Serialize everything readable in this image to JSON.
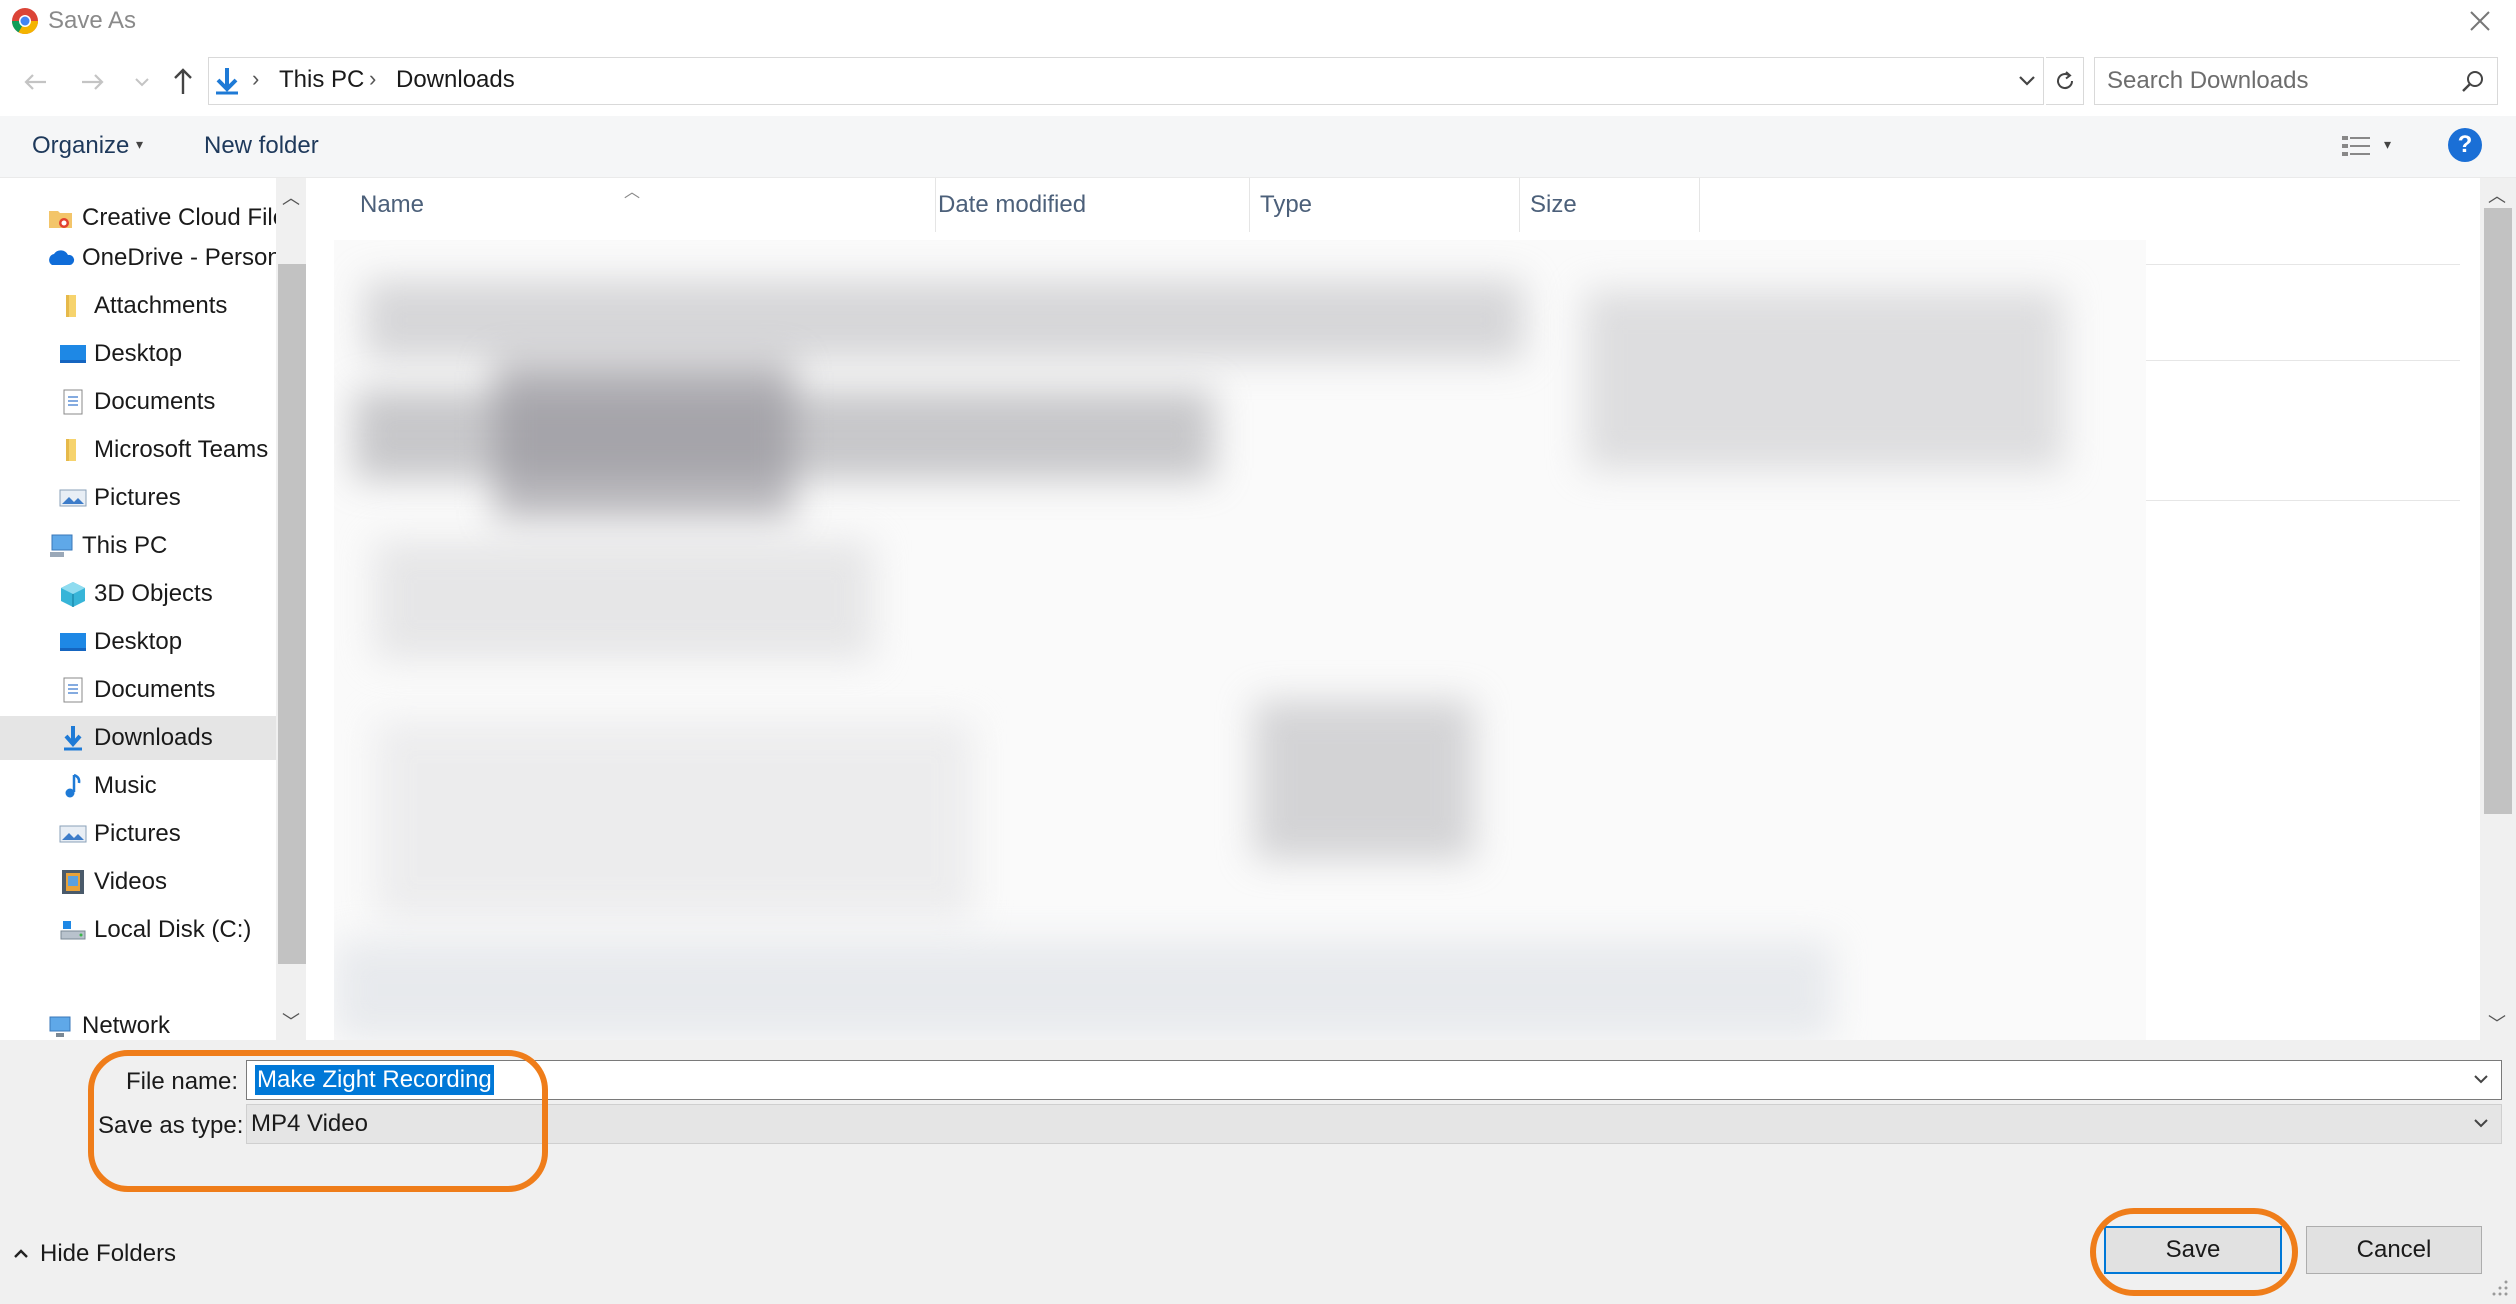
{
  "window": {
    "title": "Save As"
  },
  "address": {
    "breadcrumb": [
      "This PC",
      "Downloads"
    ],
    "search_placeholder": "Search Downloads"
  },
  "toolbar": {
    "organize_label": "Organize",
    "new_folder_label": "New folder",
    "help_label": "?"
  },
  "nav": {
    "items": [
      {
        "label": "Creative Cloud Files",
        "icon": "creative-cloud-folder-icon"
      },
      {
        "label": "OneDrive - Personal",
        "icon": "onedrive-cloud-icon"
      },
      {
        "label": "Attachments",
        "icon": "folder-icon"
      },
      {
        "label": "Desktop",
        "icon": "desktop-icon"
      },
      {
        "label": "Documents",
        "icon": "documents-icon"
      },
      {
        "label": "Microsoft Teams",
        "icon": "folder-icon"
      },
      {
        "label": "Pictures",
        "icon": "pictures-icon"
      },
      {
        "label": "This PC",
        "icon": "this-pc-icon"
      },
      {
        "label": "3D Objects",
        "icon": "3d-objects-icon"
      },
      {
        "label": "Desktop",
        "icon": "desktop-icon"
      },
      {
        "label": "Documents",
        "icon": "documents-icon"
      },
      {
        "label": "Downloads",
        "icon": "downloads-icon",
        "selected": true
      },
      {
        "label": "Music",
        "icon": "music-icon"
      },
      {
        "label": "Pictures",
        "icon": "pictures-icon"
      },
      {
        "label": "Videos",
        "icon": "videos-icon"
      },
      {
        "label": "Local Disk (C:)",
        "icon": "local-disk-icon"
      },
      {
        "label": "Network",
        "icon": "network-icon"
      }
    ]
  },
  "filelist": {
    "columns": [
      "Name",
      "Date modified",
      "Type",
      "Size"
    ]
  },
  "form": {
    "file_name_label": "File name:",
    "file_name_value": "Make Zight Recording",
    "save_type_label": "Save as type:",
    "save_type_value": "MP4 Video"
  },
  "footer": {
    "hide_folders_label": "Hide Folders",
    "save_label": "Save",
    "cancel_label": "Cancel"
  },
  "colors": {
    "accent": "#0078d7",
    "annotation": "#ef7d1a",
    "help": "#1a6fd6"
  }
}
